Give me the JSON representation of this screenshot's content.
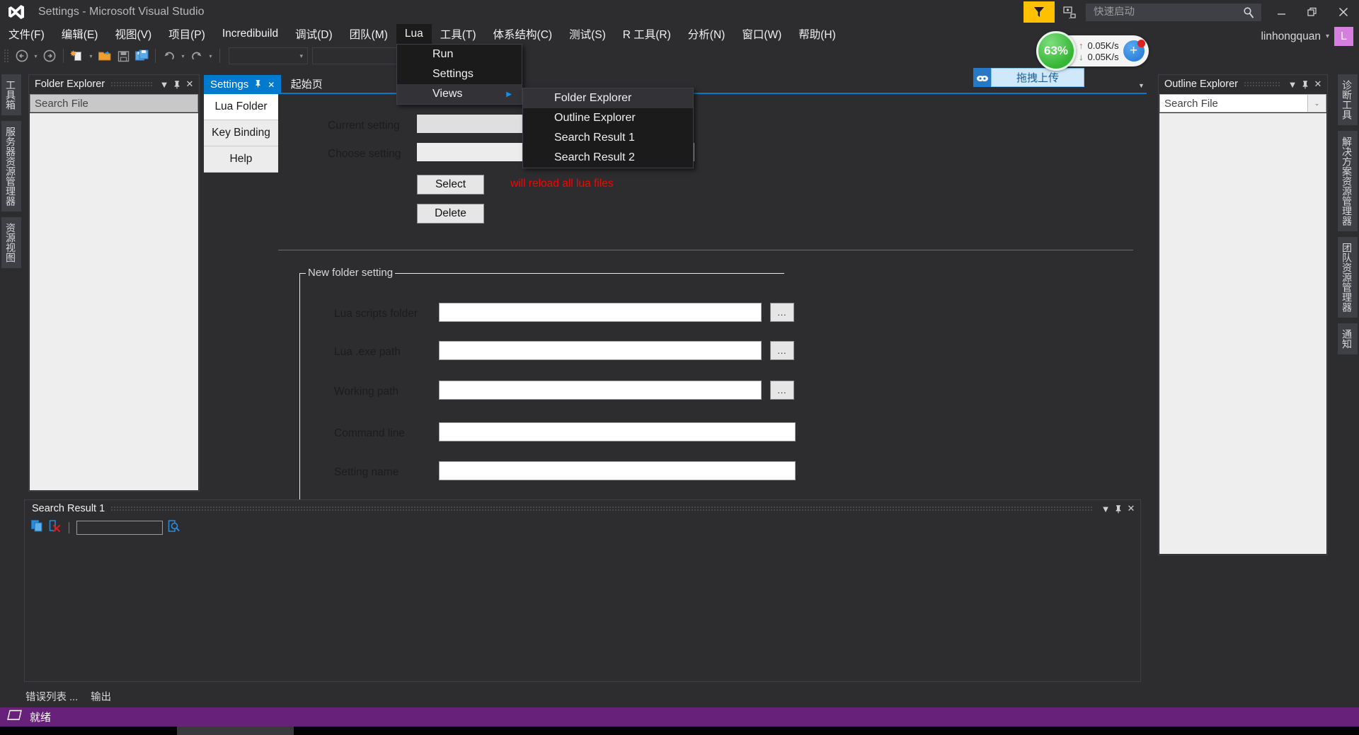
{
  "window": {
    "title": "Settings - Microsoft Visual Studio",
    "logo_icon": "visual-studio-logo-icon",
    "minimize_icon": "minimize-icon",
    "restore_icon": "restore-icon",
    "close_icon": "close-icon"
  },
  "titlebar": {
    "flag_icon": "feedback-flag-icon",
    "feedback_icon": "send-feedback-icon",
    "search_icon": "search-icon"
  },
  "quick_launch": {
    "placeholder": "快速启动",
    "value": ""
  },
  "user": {
    "name": "linhongquan",
    "avatar_initial": "L",
    "caret": "▾"
  },
  "menubar": {
    "items": [
      {
        "label": "文件(F)",
        "active": false
      },
      {
        "label": "编辑(E)",
        "active": false
      },
      {
        "label": "视图(V)",
        "active": false
      },
      {
        "label": "项目(P)",
        "active": false
      },
      {
        "label": "Incredibuild",
        "active": false
      },
      {
        "label": "调试(D)",
        "active": false
      },
      {
        "label": "团队(M)",
        "active": false
      },
      {
        "label": "Lua",
        "active": true
      },
      {
        "label": "工具(T)",
        "active": false
      },
      {
        "label": "体系结构(C)",
        "active": false
      },
      {
        "label": "测试(S)",
        "active": false
      },
      {
        "label": "R 工具(R)",
        "active": false
      },
      {
        "label": "分析(N)",
        "active": false
      },
      {
        "label": "窗口(W)",
        "active": false
      },
      {
        "label": "帮助(H)",
        "active": false
      }
    ]
  },
  "lua_menu": {
    "items": [
      {
        "label": "Run",
        "has_submenu": false,
        "highlight": false
      },
      {
        "label": "Settings",
        "has_submenu": false,
        "highlight": false
      },
      {
        "label": "Views",
        "has_submenu": true,
        "highlight": true,
        "arrow": "▶"
      }
    ]
  },
  "views_submenu": {
    "items": [
      {
        "label": "Folder Explorer",
        "highlight": true
      },
      {
        "label": "Outline Explorer",
        "highlight": false
      },
      {
        "label": "Search Result 1",
        "highlight": false
      },
      {
        "label": "Search Result 2",
        "highlight": false
      }
    ]
  },
  "toolbar": {
    "back_icon": "navigate-back-icon",
    "forward_icon": "navigate-forward-icon",
    "new_file_icon": "new-file-icon",
    "open_file_icon": "open-folder-icon",
    "save_icon": "save-icon",
    "save_all_icon": "save-all-icon",
    "undo_icon": "undo-icon",
    "redo_icon": "redo-icon",
    "caret": "▾"
  },
  "left_dock_tabs": [
    {
      "label": "工具箱"
    },
    {
      "label": "服务器资源管理器"
    },
    {
      "label": "资源视图"
    }
  ],
  "right_dock_tabs": [
    {
      "label": "诊断工具"
    },
    {
      "label": "解决方案资源管理器"
    },
    {
      "label": "团队资源管理器"
    },
    {
      "label": "通知"
    }
  ],
  "folder_explorer": {
    "title": "Folder Explorer",
    "search_placeholder": "Search File",
    "search_value": "",
    "dropdown_icon": "chevron-down-icon",
    "pin_icon": "pin-icon",
    "close_icon": "close-icon"
  },
  "outline_explorer": {
    "title": "Outline Explorer",
    "search_placeholder": "Search File",
    "search_value": "",
    "dropdown_icon": "chevron-down-icon",
    "pin_icon": "pin-icon",
    "close_icon": "close-icon",
    "filter_caret": "⌄"
  },
  "editor_tabs": [
    {
      "label": "Settings",
      "active": true,
      "pin_icon": "pin-icon",
      "close_icon": "close-icon"
    },
    {
      "label": "起始页",
      "active": false
    }
  ],
  "settings_page": {
    "side_tabs": [
      {
        "label": "Lua Folder",
        "active": true
      },
      {
        "label": "Key Binding",
        "active": false
      },
      {
        "label": "Help",
        "active": false
      }
    ],
    "current_setting_label": "Current setting",
    "current_setting_value": "",
    "choose_setting_label": "Choose setting",
    "choose_setting_value": "",
    "select_button": "Select",
    "delete_button": "Delete",
    "warning_text": "will reload all lua files",
    "group": {
      "legend": "New folder setting",
      "fields": [
        {
          "label": "Lua scripts folder",
          "value": "",
          "browse": "...",
          "has_browse": true
        },
        {
          "label": "Lua .exe path",
          "value": "",
          "browse": "...",
          "has_browse": true
        },
        {
          "label": "Working path",
          "value": "",
          "browse": "...",
          "has_browse": true
        },
        {
          "label": "Command line",
          "value": "",
          "has_browse": false
        },
        {
          "label": "Setting name",
          "value": "",
          "has_browse": false
        }
      ]
    }
  },
  "search_result_panel": {
    "title": "Search Result 1",
    "copy_icon": "copy-icon",
    "remove_icon": "remove-file-icon",
    "find_icon": "find-in-document-icon",
    "input_value": "",
    "dropdown_icon": "chevron-down-icon",
    "pin_icon": "pin-icon",
    "close_icon": "close-icon"
  },
  "bottom_tabs": [
    {
      "label": "错误列表 ..."
    },
    {
      "label": "输出"
    }
  ],
  "statusbar": {
    "icon": "ready-indicator-icon",
    "text": "就绪",
    "color": "#68217A"
  },
  "net_widget": {
    "cpu_percent": "63%",
    "upload_rate": "0.05K/s",
    "download_rate": "0.05K/s",
    "up_arrow": "↑",
    "down_arrow": "↓",
    "plus": "+",
    "upload_badge": "拖拽上传",
    "upload_icon": "cloud-upload-icon"
  },
  "colors": {
    "accent": "#007ACC",
    "status": "#68217A",
    "chrome": "#2d2d30",
    "panel_body": "#eeeeee",
    "warning": "#FF0000",
    "avatar": "#D67FE0",
    "flag": "#FFC000"
  }
}
